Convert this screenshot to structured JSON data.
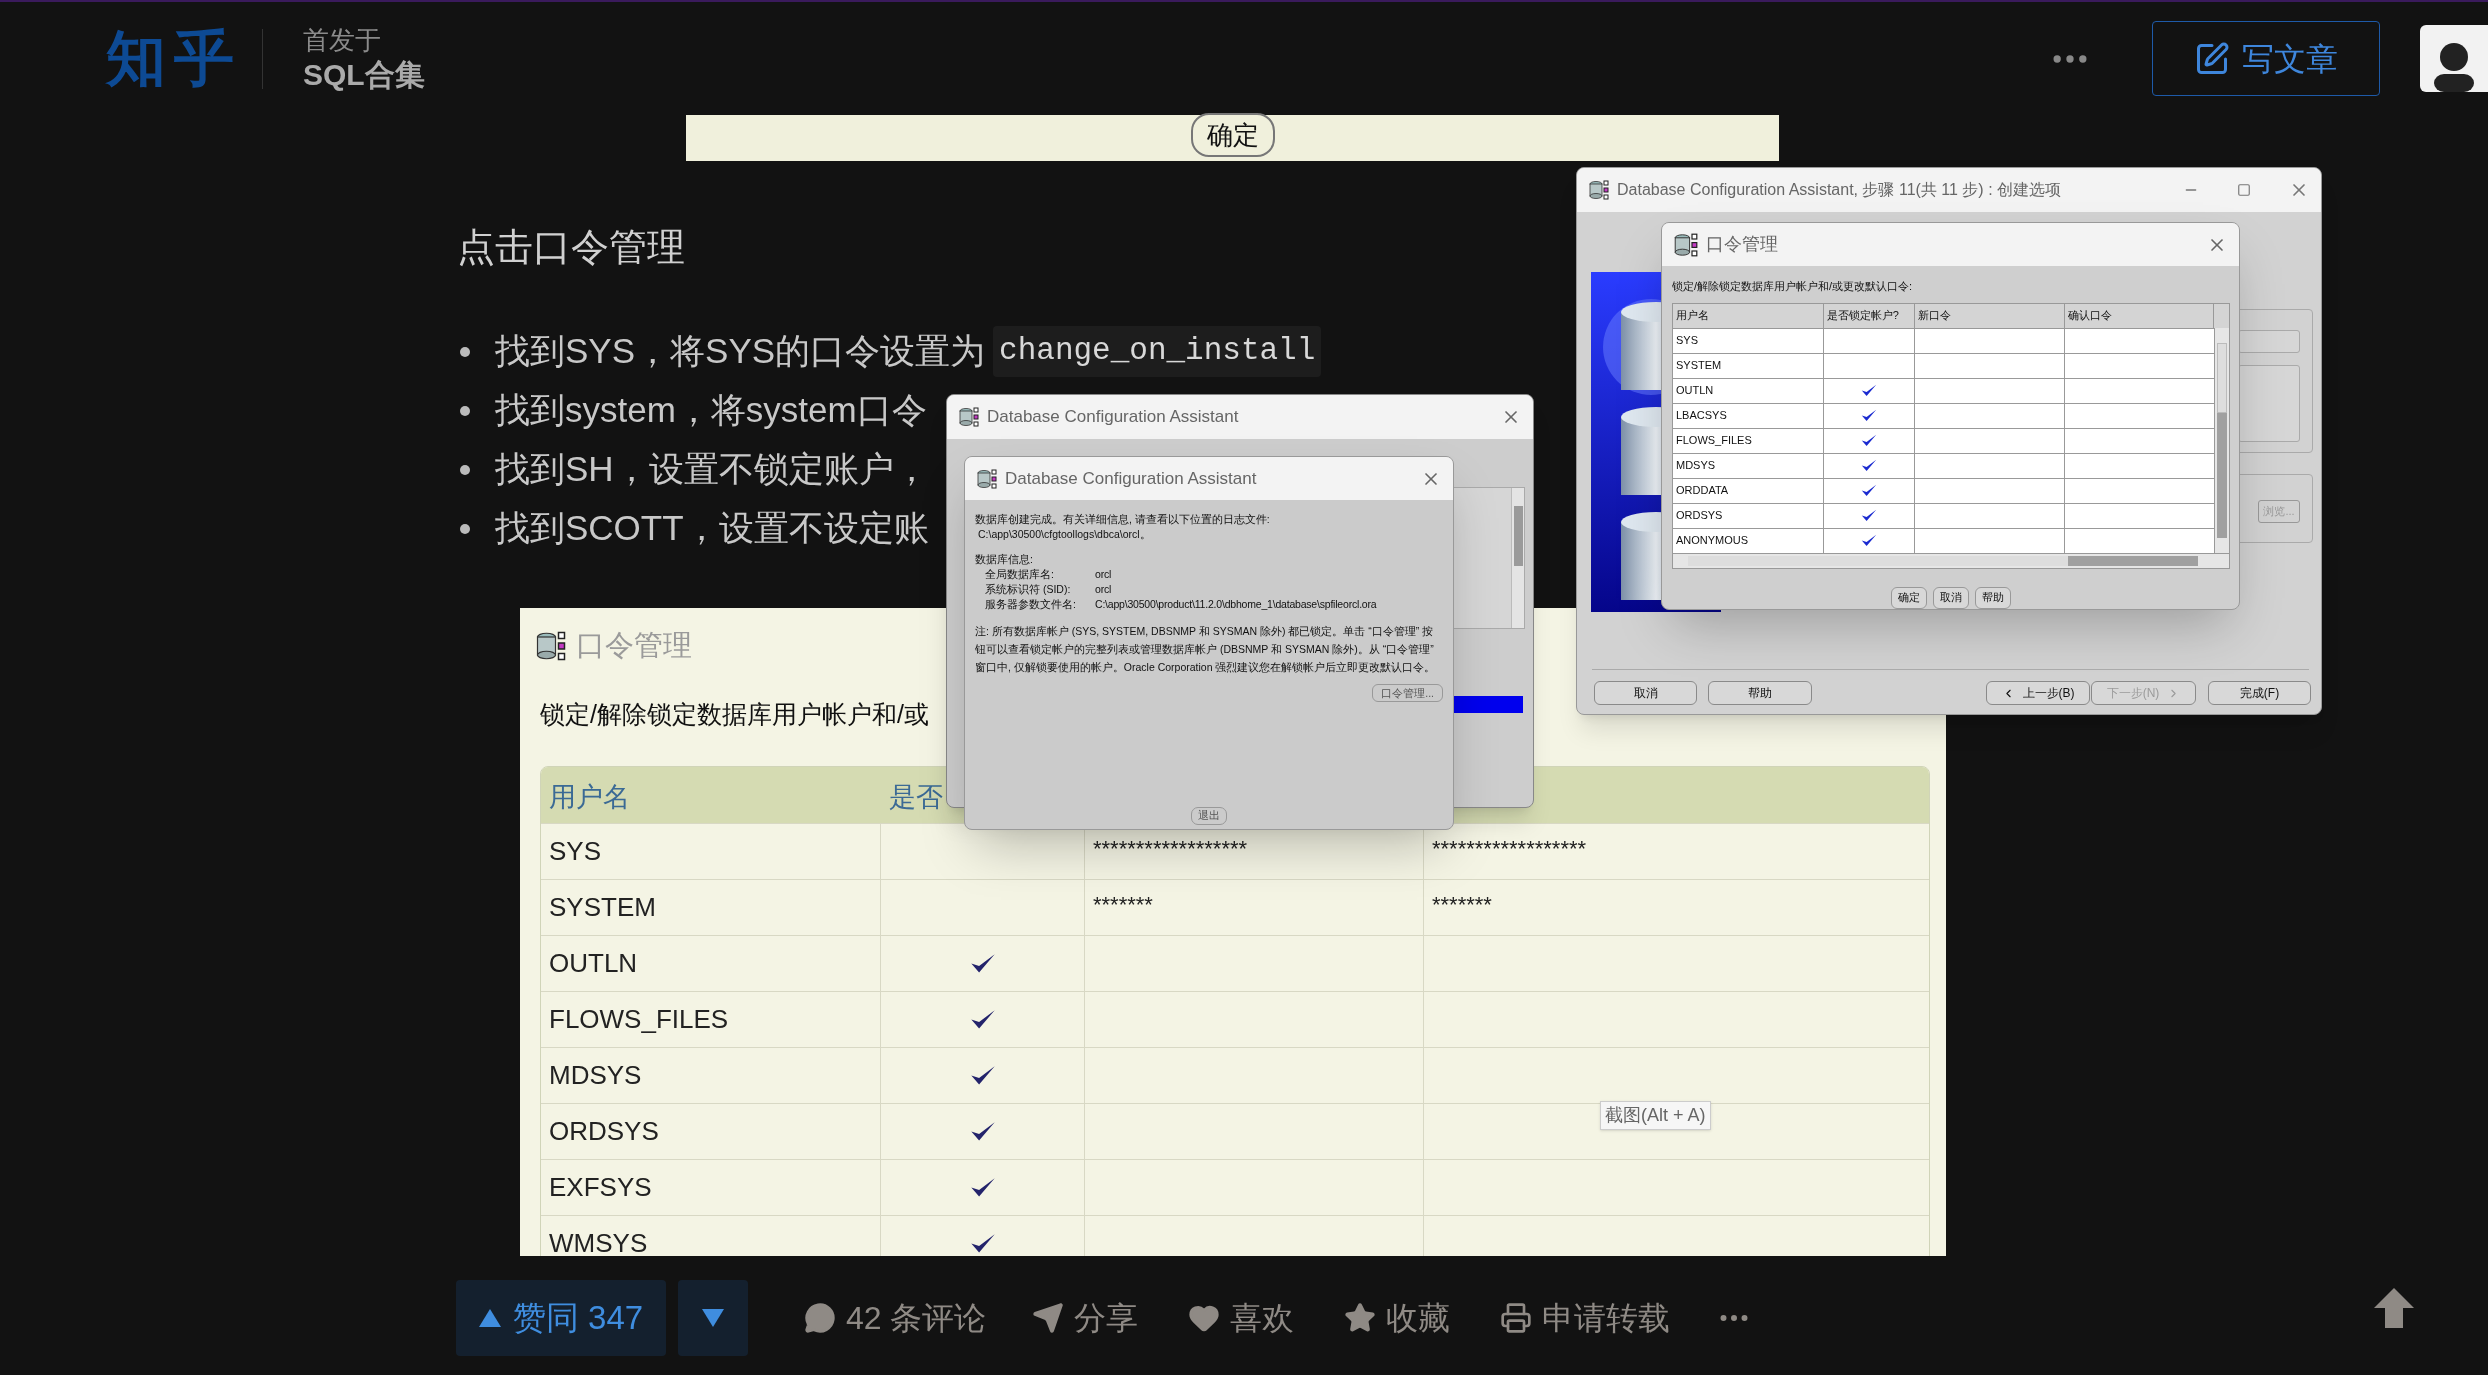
{
  "header": {
    "logo": "知乎",
    "column_label": "首发于",
    "column_name": "SQL合集",
    "write_button": "写文章"
  },
  "article": {
    "top_image": {
      "button": "确定"
    },
    "heading": "点击口令管理",
    "bullets": [
      {
        "text": "找到SYS，将SYS的口令设置为",
        "code": "change_on_install"
      },
      {
        "text": "找到system，将system口令"
      },
      {
        "text": "找到SH，设置不锁定账户，"
      },
      {
        "text": "找到SCOTT，设置不设定账"
      }
    ],
    "figure": {
      "title": "口令管理",
      "caption": "锁定/解除锁定数据库用户帐户和/或",
      "columns": [
        "用户名",
        "是否"
      ],
      "rows": [
        {
          "username": "SYS",
          "locked": false,
          "new_password": "******************",
          "confirm_password": "******************"
        },
        {
          "username": "SYSTEM",
          "locked": false,
          "new_password": "*******",
          "confirm_password": "*******"
        },
        {
          "username": "OUTLN",
          "locked": true
        },
        {
          "username": "FLOWS_FILES",
          "locked": true
        },
        {
          "username": "MDSYS",
          "locked": true
        },
        {
          "username": "ORDSYS",
          "locked": true
        },
        {
          "username": "EXFSYS",
          "locked": true
        },
        {
          "username": "WMSYS",
          "locked": true
        }
      ],
      "tooltip": "截图(Alt + A)"
    }
  },
  "summary_window": {
    "title": "Database Configuration Assistant",
    "progress": {
      "level": 1
    },
    "dialog": {
      "title": "Database Configuration Assistant",
      "message": "数据库创建完成。有关详细信息, 请查看以下位置的日志文件:",
      "log_path": "C:\\app\\30500\\cfgtoollogs\\dbca\\orcl。",
      "info_heading": "数据库信息:",
      "info": [
        {
          "label": "全局数据库名:",
          "value": "orcl"
        },
        {
          "label": "系统标识符 (SID):",
          "value": "orcl"
        },
        {
          "label": "服务器参数文件名:",
          "value": "C:\\app\\30500\\product\\11.2.0\\dbhome_1\\database\\spfileorcl.ora"
        }
      ],
      "note": "注: 所有数据库帐户 (SYS, SYSTEM, DBSNMP 和 SYSMAN 除外) 都已锁定。单击 “口令管理” 按钮可以查看锁定帐户的完整列表或管理数据库帐户 (DBSNMP 和 SYSMAN 除外)。从 “口令管理” 窗口中, 仅解锁要使用的帐户。Oracle Corporation 强烈建议您在解锁帐户后立即更改默认口令。",
      "password_button": "口令管理...",
      "exit_button": "退出"
    }
  },
  "wizard_window": {
    "title": "Database Configuration Assistant, 步骤 11(共 11 步) : 创建选项",
    "browse_button": {
      "label": "浏览...",
      "disabled": true
    },
    "buttons": [
      {
        "label": "取消",
        "kind": "plain",
        "disabled": false
      },
      {
        "label": "帮助",
        "kind": "plain",
        "disabled": false
      },
      {
        "label": "上一步(B)",
        "kind": "back",
        "disabled": false
      },
      {
        "label": "下一步(N)",
        "kind": "next",
        "disabled": true
      },
      {
        "label": "完成(F)",
        "kind": "plain",
        "disabled": false
      }
    ],
    "dialog": {
      "title": "口令管理",
      "prompt": "锁定/解除锁定数据库用户帐户和/或更改默认口令:",
      "columns": [
        "用户名",
        "是否锁定帐户?",
        "新口令",
        "确认口令"
      ],
      "rows": [
        {
          "username": "SYS",
          "locked": false
        },
        {
          "username": "SYSTEM",
          "locked": false
        },
        {
          "username": "OUTLN",
          "locked": true
        },
        {
          "username": "LBACSYS",
          "locked": true
        },
        {
          "username": "FLOWS_FILES",
          "locked": true
        },
        {
          "username": "MDSYS",
          "locked": true
        },
        {
          "username": "ORDDATA",
          "locked": true
        },
        {
          "username": "ORDSYS",
          "locked": true
        },
        {
          "username": "ANONYMOUS",
          "locked": true
        }
      ],
      "buttons": [
        "确定",
        "取消",
        "帮助"
      ]
    }
  },
  "actions": {
    "upvote": "赞同 347",
    "comments": "42 条评论",
    "share": "分享",
    "like": "喜欢",
    "favorite": "收藏",
    "repost": "申请转载"
  }
}
